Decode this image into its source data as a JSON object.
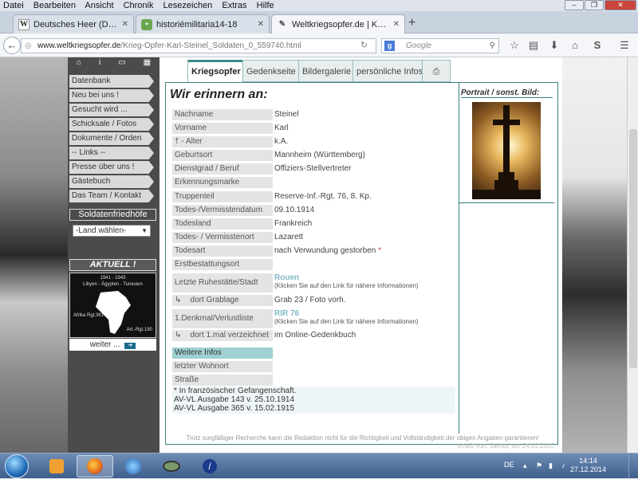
{
  "menu": [
    "Datei",
    "Bearbeiten",
    "Ansicht",
    "Chronik",
    "Lesezeichen",
    "Extras",
    "Hilfe"
  ],
  "tabs": [
    {
      "label": "Deutsches Heer (Deutsches ...",
      "favicon": "W"
    },
    {
      "label": "historiémilitaria14-18",
      "favicon": "chat-bubble"
    },
    {
      "label": "Weltkriegsopfer.de | Kriegs...",
      "favicon": "pen"
    }
  ],
  "url": {
    "domain": "www.weltkriegsopfer.de",
    "path": "/Krieg-Opfer-Karl-Steinel_Soldaten_0_559740.html"
  },
  "search_placeholder": "Google",
  "sidebar": {
    "items": [
      "Datenbank",
      "Neu bei uns !",
      "Gesucht wird ...",
      "Schicksale / Fotos",
      "Dokumente / Orden",
      "-- Links --",
      "Presse über uns !",
      "Gästebuch",
      "Das Team / Kontakt"
    ],
    "soldatenfriedhoefe": "Soldatenfriedhöfe",
    "land_select": "-Land wählen-",
    "aktuell": "AKTUELL !",
    "aktuell_image_text": [
      "1941 - 1943",
      "Libyen - Ägypten - Tunesien",
      "Afrika Rgt.361",
      "Art.-Rgt.190"
    ],
    "weiter": "weiter ..."
  },
  "content_tabs": [
    "Kriegsopfer",
    "Gedenkseite",
    "Bildergalerie",
    "persönliche Infos"
  ],
  "heading": "Wir erinnern an:",
  "rows": [
    {
      "label": "Nachname",
      "value": "Steinel"
    },
    {
      "label": "Vorname",
      "value": "Karl"
    },
    {
      "label": "† - Alter",
      "value": "k.A."
    },
    {
      "label": "Geburtsort",
      "value": "Mannheim (Württemberg)"
    },
    {
      "label": "Dienstgrad / Beruf",
      "value": "Offiziers-Stellvertreter"
    },
    {
      "label": "Erkennungsmarke",
      "value": ""
    },
    {
      "label": "Truppenteil",
      "value": "Reserve-Inf.-Rgt. 76, 8. Kp."
    },
    {
      "label": "Todes-/Vermisstendatum",
      "value": "09.10.1914"
    },
    {
      "label": "Todesland",
      "value": "Frankreich"
    },
    {
      "label": "Todes- / Vermisstenort",
      "value": "Lazarett"
    },
    {
      "label": "Todesart",
      "value": "nach Verwundung gestorben"
    },
    {
      "label": "Erstbestattungsort",
      "value": ""
    }
  ],
  "ruhestaette": {
    "label": "Letzte Ruhestätte/Stadt",
    "link": "Rouen",
    "note": "(Klicken Sie auf den Link für nähere Informationen)"
  },
  "grablage": {
    "label": "dort Grablage",
    "value": "Grab 23 / Foto vorh.",
    "arrow": "↳"
  },
  "denkmal": {
    "label": "1.Denkmal/Verlustliste",
    "link": "RIR 76",
    "note": "(Klicken Sie auf den Link für nähere Informationen)"
  },
  "verzeichnet": {
    "label": "dort 1.mal verzeichnet",
    "value": "im Online-Gedenkbuch",
    "arrow": "↳"
  },
  "weitere_infos": "Weitere Infos",
  "rows2": [
    {
      "label": "letzter Wohnort",
      "value": ""
    },
    {
      "label": "Straße",
      "value": ""
    }
  ],
  "footnotes": [
    "* In französischer Gefangenschaft.",
    "AV-VL Ausgabe 143 v. 25.10.1914",
    "AV-VL Ausgabe 365 v. 15.02.1915"
  ],
  "portrait_title": "Portrait / sonst. Bild:",
  "disclaimer": "Trotz sorgfältiger Recherche kann die Redaktion nicht für die Richtigkeit und Vollständigkeit der obigen Angaben garantieren!",
  "credit": "erfaßt von: Jakobi, am 24.01.2010",
  "taskbar": {
    "lang": "DE",
    "time": "14:14",
    "date": "27.12.2014"
  },
  "colors": {
    "teal": "#3b7f7f",
    "highlight": "#9fd0d2",
    "link": "#7fb9c4"
  }
}
